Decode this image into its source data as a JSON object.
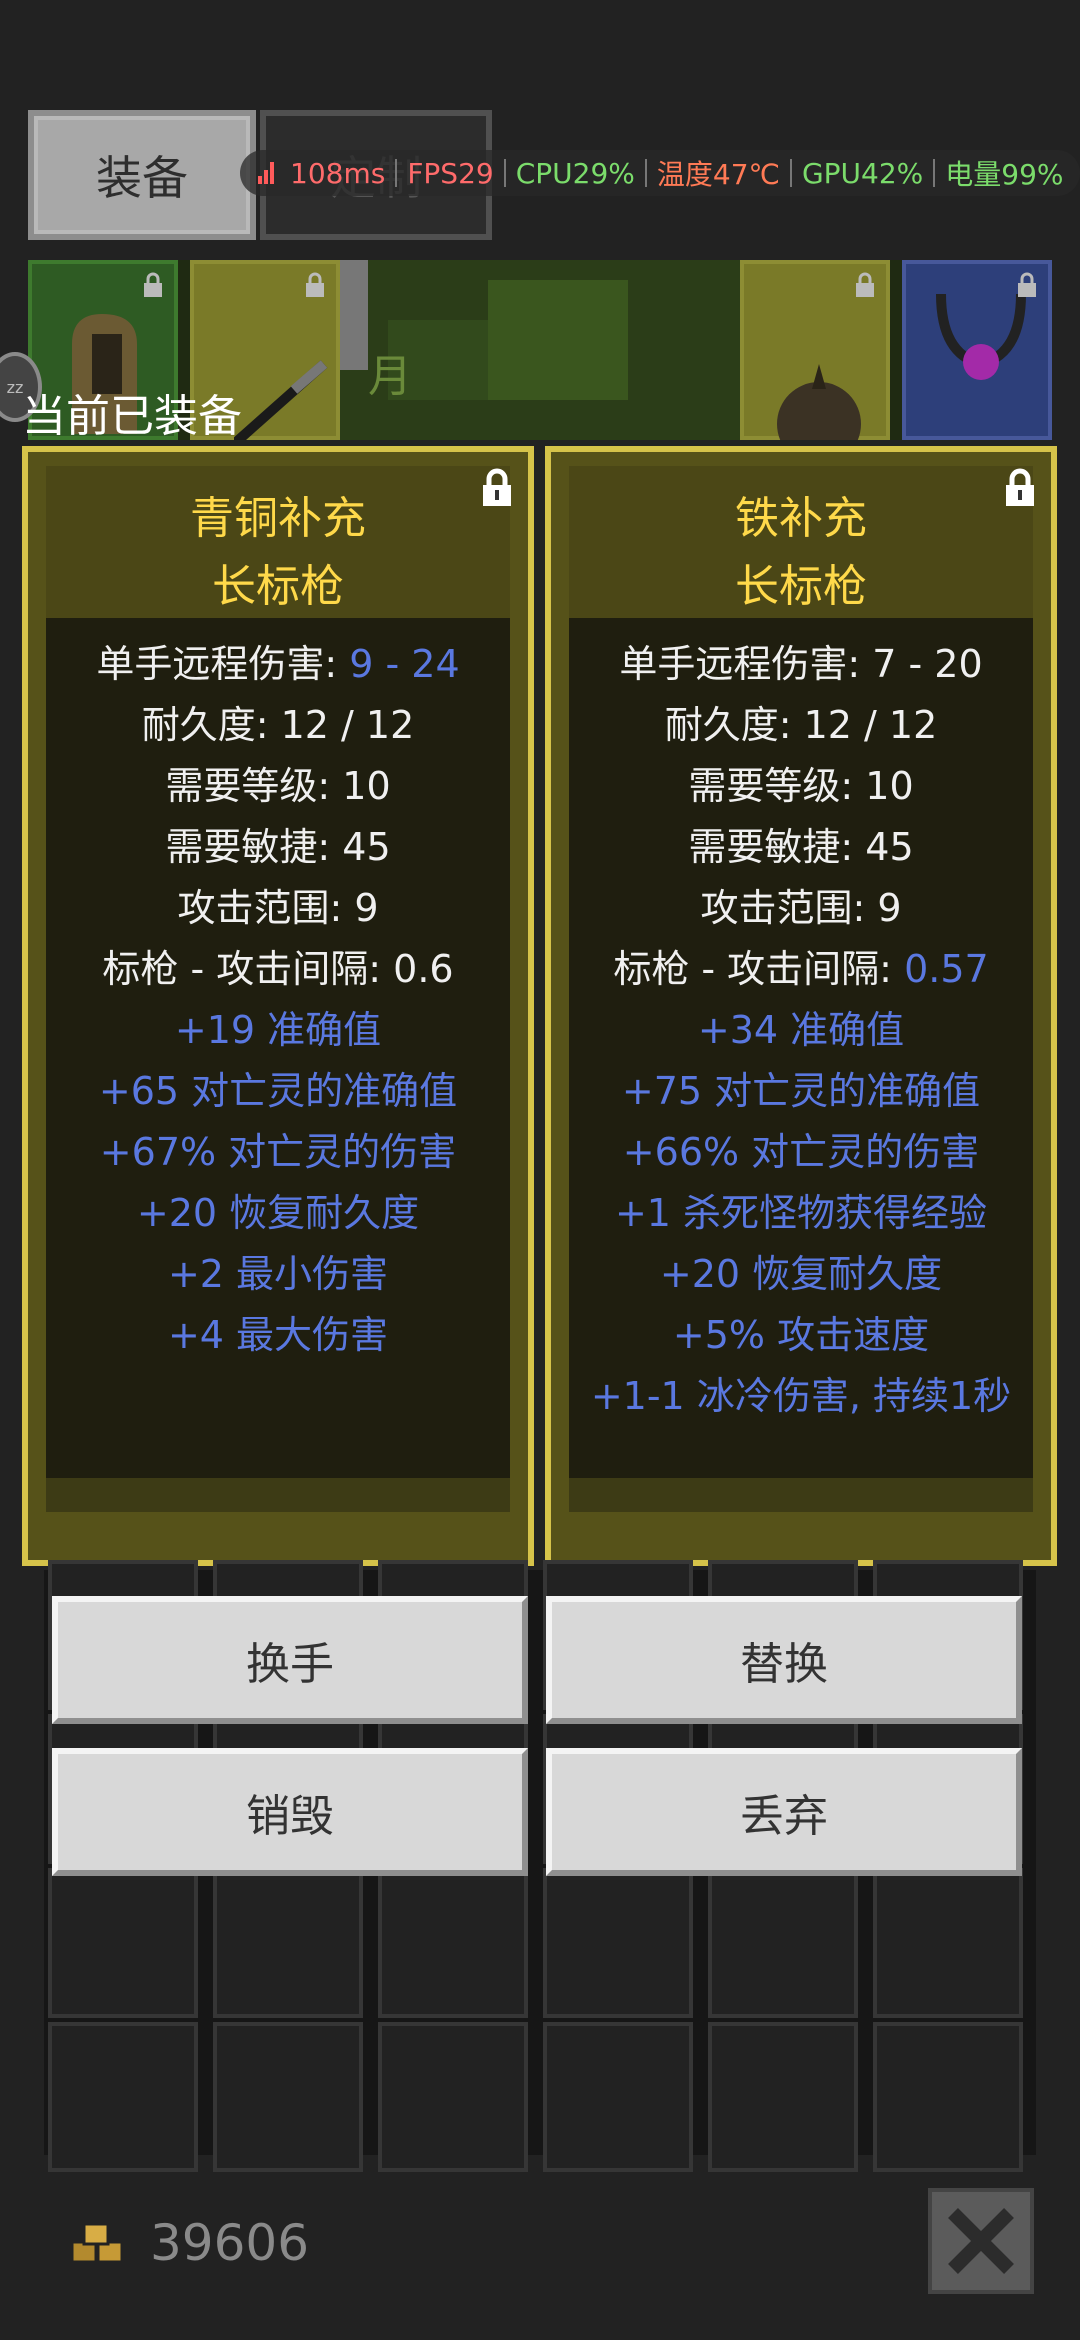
{
  "tabs": {
    "equipment": "装备",
    "other": "定制"
  },
  "perf": [
    {
      "text": "108ms",
      "color": "#ff6b6b"
    },
    {
      "text": "FPS29",
      "color": "#ff6b6b"
    },
    {
      "text": "CPU29%",
      "color": "#7bdc6b"
    },
    {
      "text": "温度47℃",
      "color": "#ff7a55"
    },
    {
      "text": "GPU42%",
      "color": "#7bdc6b"
    },
    {
      "text": "电量99%",
      "color": "#7bdc6b"
    }
  ],
  "strip": {
    "partial_text": "月"
  },
  "equipped_label": "当前已装备",
  "cards": [
    {
      "title_line1": "青铜补充",
      "title_line2": "长标枪",
      "stats": [
        {
          "label": "单手远程伤害: ",
          "value": "9 - 24",
          "value_blue": true
        },
        {
          "label": "耐久度: ",
          "value": "12 / 12"
        },
        {
          "label": "需要等级: ",
          "value": "10"
        },
        {
          "label": "需要敏捷: ",
          "value": "45"
        },
        {
          "label": "攻击范围: ",
          "value": "9"
        },
        {
          "label": "标枪 - 攻击间隔: ",
          "value": "0.6"
        }
      ],
      "mods": [
        "+19 准确值",
        "+65 对亡灵的准确值",
        "+67% 对亡灵的伤害",
        "+20 恢复耐久度",
        "+2 最小伤害",
        "+4 最大伤害"
      ]
    },
    {
      "title_line1": "铁补充",
      "title_line2": "长标枪",
      "stats": [
        {
          "label": "单手远程伤害: ",
          "value": "7 - 20"
        },
        {
          "label": "耐久度: ",
          "value": "12 / 12"
        },
        {
          "label": "需要等级: ",
          "value": "10"
        },
        {
          "label": "需要敏捷: ",
          "value": "45"
        },
        {
          "label": "攻击范围: ",
          "value": "9"
        },
        {
          "label": "标枪 - 攻击间隔: ",
          "value": "0.57",
          "value_blue": true
        }
      ],
      "mods": [
        "+34 准确值",
        "+75 对亡灵的准确值",
        "+66% 对亡灵的伤害",
        "+1 杀死怪物获得经验",
        "+20 恢复耐久度",
        "+5% 攻击速度",
        "+1-1 冰冷伤害, 持续1秒"
      ]
    }
  ],
  "buttons": {
    "swap_hand": "换手",
    "replace": "替换",
    "destroy": "销毁",
    "drop": "丢弃"
  },
  "gold": "39606",
  "colors": {
    "card_border": "#d6c34a",
    "title": "#ffd94a",
    "mod": "#5a78e0"
  }
}
